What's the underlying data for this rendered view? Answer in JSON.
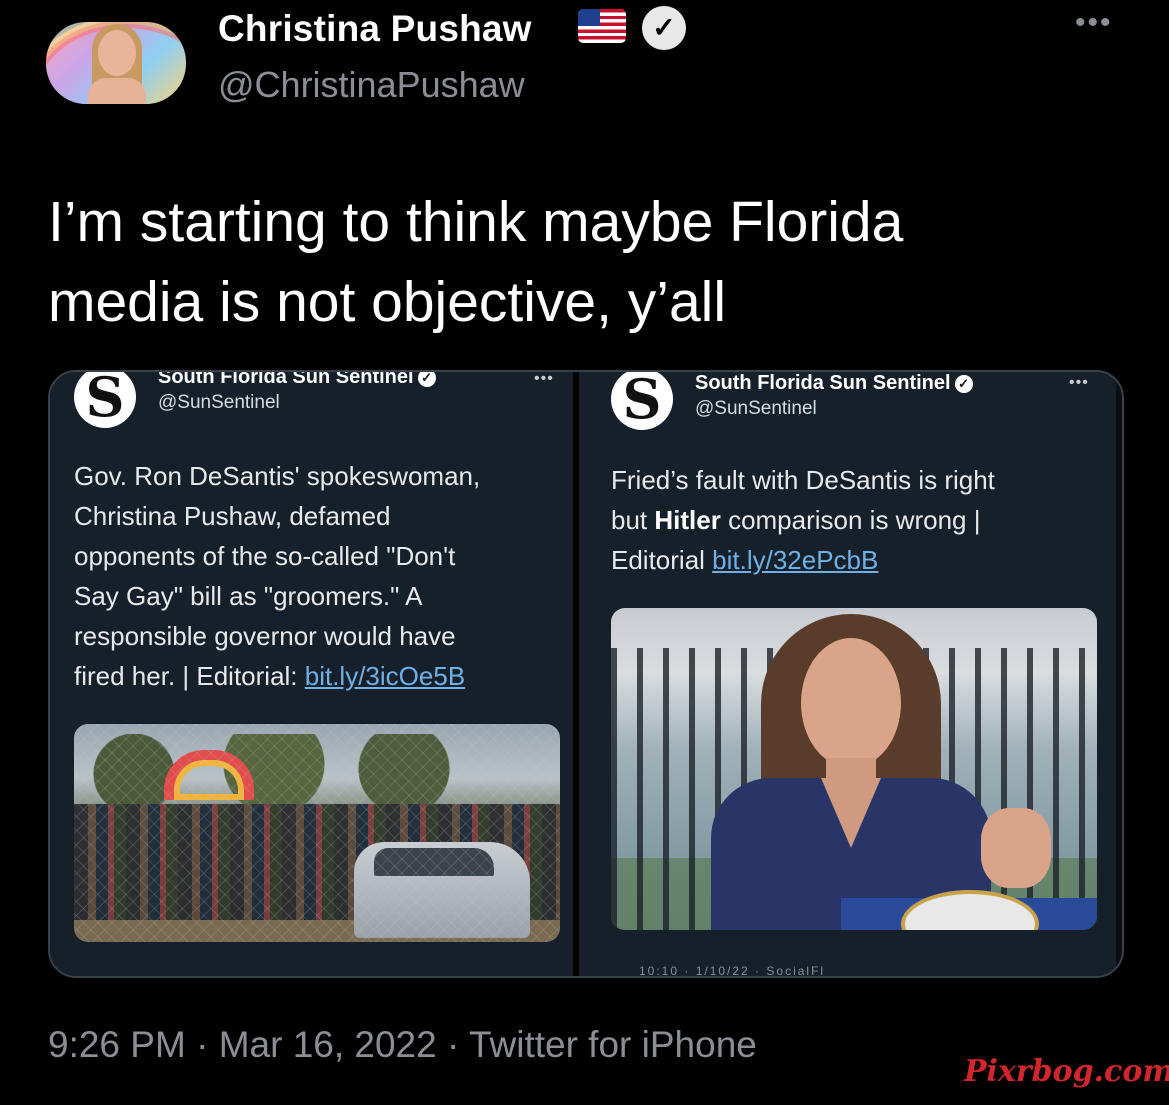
{
  "author": {
    "display_name": "Christina Pushaw",
    "handle": "@ChristinaPushaw",
    "flag_icon": "us-flag-icon",
    "verified_icon": "verified-badge-icon",
    "more_label": "•••"
  },
  "tweet": {
    "line1": "I’m starting to think maybe Florida",
    "line2": "media is not objective, y’all"
  },
  "embedded": [
    {
      "source_name": "South Florida Sun Sentinel",
      "source_handle": "@SunSentinel",
      "logo_letter": "S",
      "more_label": "•••",
      "text_lines": [
        "Gov. Ron DeSantis' spokeswoman,",
        "Christina Pushaw, defamed",
        "opponents of the so-called \"Don't",
        "Say Gay\" bill as \"groomers.\" A",
        "responsible governor would have",
        "fired her. | Editorial: "
      ],
      "link": "bit.ly/3icOe5B"
    },
    {
      "source_name": "South Florida Sun Sentinel",
      "source_handle": "@SunSentinel",
      "logo_letter": "S",
      "more_label": "•••",
      "line1": "Fried’s fault with DeSantis is right",
      "line2_pre": "but ",
      "line2_bold": "Hitler",
      "line2_post": " comparison is wrong |",
      "line3": "Editorial ",
      "link": "bit.ly/32ePcbB",
      "clipped_meta": "10:10 · 1/10/22 · SocialFl"
    }
  ],
  "footer": {
    "time": "9:26 PM",
    "sep1": " · ",
    "date": "Mar 16, 2022",
    "sep2": " · ",
    "client": "Twitter for iPhone"
  },
  "watermark": "Pixrbog.com",
  "colors": {
    "background": "#000000",
    "card": "#16202b",
    "secondary_text": "#8b8f95",
    "link": "#6fb1e6",
    "watermark": "#d3262b"
  }
}
